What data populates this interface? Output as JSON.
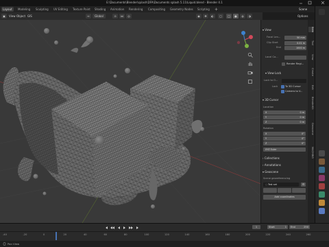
{
  "window": {
    "title": "E:\\Documents\\Blender\\splash\\DFA\\Documents splash 5.11\\Liquid.blend - Blender 4.1"
  },
  "tabs": [
    "Layout",
    "Modeling",
    "Sculpting",
    "UV Editing",
    "Texture Paint",
    "Shading",
    "Animation",
    "Rendering",
    "Compositing",
    "Geometry Nodes",
    "Scripting"
  ],
  "scene_label": "Scene",
  "header": {
    "view": "View",
    "object": "Object",
    "gis": "GIS",
    "global": "Global",
    "options": "Options"
  },
  "npanel": {
    "view_section": "View",
    "focal_label": "Focal Len...",
    "focal_value": "50 mm",
    "clip_start_label": "Clip Start",
    "clip_start_value": "0.01 m",
    "end_label": "End",
    "end_value": "1000 m",
    "local_cam_label": "Local Ca...",
    "render_region": "Render Regi...",
    "view_lock_section": "View Lock",
    "lock_to_label": "Lock to O...",
    "lock_label": "Lock",
    "to_3d_cursor": "To 3D Cursor",
    "camera_to_v": "Camera to V...",
    "cursor_section": "3D Cursor",
    "location_label": "Location",
    "loc_x": "X",
    "loc_x_val": "0 m",
    "loc_y": "Y",
    "loc_y_val": "0 m",
    "loc_z": "Z",
    "loc_z_val": "0 m",
    "rotation_label": "Rotation",
    "rot_x": "X",
    "rot_x_val": "0°",
    "rot_y": "Y",
    "rot_y_val": "0°",
    "rot_z": "Z",
    "rot_z_val": "0°",
    "rot_mode": "XYZ Euler",
    "collections": "Collections",
    "annotations": "Annotations",
    "geoscene": "Geoscene",
    "scene_georef": "Scene georeferencing",
    "georef_item": "Test set",
    "add_coords": "Add coordinates"
  },
  "vtabs": [
    "Item",
    "Tool",
    "View",
    "Create",
    "Edit",
    "BlenderKit",
    "Geoscene",
    "MACHIN3"
  ],
  "timeline": {
    "frames": [
      "-40",
      "-20",
      "0",
      "20",
      "40",
      "60",
      "80",
      "100",
      "120",
      "140",
      "160",
      "180",
      "200",
      "220",
      "240",
      "260"
    ],
    "start_label": "Start",
    "start_value": "1",
    "end_label": "End",
    "end_value": "250",
    "current": "1"
  },
  "status": {
    "pan_view": "Pan View"
  },
  "colors": {
    "accent": "#4772b3",
    "viewport_bg": "#393939",
    "panel_bg": "#2b2b2b",
    "timeline_marker": "#4772b3"
  }
}
